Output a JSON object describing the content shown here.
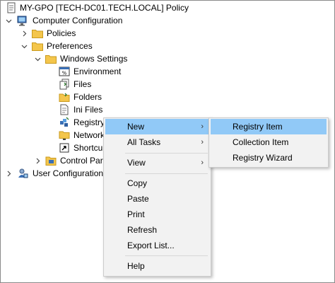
{
  "tree": {
    "root": {
      "label": "MY-GPO [TECH-DC01.TECH.LOCAL] Policy",
      "icon": "policy-scroll-icon"
    },
    "computer_config": {
      "label": "Computer Configuration",
      "icon": "computer-icon"
    },
    "policies": {
      "label": "Policies",
      "icon": "folder-icon"
    },
    "preferences": {
      "label": "Preferences",
      "icon": "folder-icon"
    },
    "windows_settings": {
      "label": "Windows Settings",
      "icon": "folder-icon"
    },
    "items": [
      {
        "label": "Environment",
        "icon": "environment-icon"
      },
      {
        "label": "Files",
        "icon": "files-icon"
      },
      {
        "label": "Folders",
        "icon": "folders-icon"
      },
      {
        "label": "Ini Files",
        "icon": "ini-files-icon"
      },
      {
        "label": "Registry",
        "icon": "registry-icon"
      },
      {
        "label": "Network",
        "icon": "network-shares-icon"
      },
      {
        "label": "Shortcu",
        "icon": "shortcuts-icon"
      }
    ],
    "control_panel": {
      "label": "Control Par",
      "icon": "control-panel-icon"
    },
    "user_config": {
      "label": "User Configuration",
      "icon": "user-config-icon"
    }
  },
  "context_menu": {
    "items": [
      {
        "label": "New",
        "submenu": true,
        "highlighted": true
      },
      {
        "label": "All Tasks",
        "submenu": true
      },
      {
        "label": "View",
        "submenu": true
      },
      {
        "label": "Copy"
      },
      {
        "label": "Paste"
      },
      {
        "label": "Print"
      },
      {
        "label": "Refresh"
      },
      {
        "label": "Export List..."
      },
      {
        "label": "Help"
      }
    ]
  },
  "submenu": {
    "items": [
      {
        "label": "Registry Item",
        "highlighted": true
      },
      {
        "label": "Collection Item"
      },
      {
        "label": "Registry Wizard"
      }
    ]
  },
  "colors": {
    "highlight": "#91c9f7",
    "menu_bg": "#f2f2f2",
    "folder": "#f4c64c"
  }
}
